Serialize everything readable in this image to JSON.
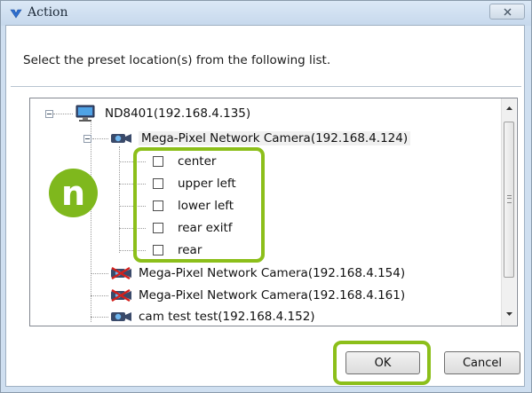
{
  "window": {
    "title": "Action",
    "close_glyph": "✕"
  },
  "prompt_text": "Select the preset location(s) from the following list.",
  "tree": {
    "root": {
      "label": "ND8401(192.168.4.135)",
      "icon": "computer-icon"
    },
    "camera_1": {
      "label": "Mega-Pixel Network Camera(192.168.4.124)",
      "icon": "camera-icon"
    },
    "presets": [
      {
        "label": "center",
        "checked": false
      },
      {
        "label": "upper left",
        "checked": false
      },
      {
        "label": "lower left",
        "checked": false
      },
      {
        "label": "rear exitf",
        "checked": false
      },
      {
        "label": "rear",
        "checked": false
      }
    ],
    "camera_2": {
      "label": "Mega-Pixel Network Camera(192.168.4.154)",
      "icon": "camera-offline-icon"
    },
    "camera_3": {
      "label": "Mega-Pixel Network Camera(192.168.4.161)",
      "icon": "camera-offline-icon"
    },
    "camera_4": {
      "label": "cam test test(192.168.4.152)",
      "icon": "camera-icon"
    }
  },
  "annotation": {
    "marker_text": "n"
  },
  "buttons": {
    "ok_label": "OK",
    "cancel_label": "Cancel"
  },
  "colors": {
    "highlight": "#8cbf1a",
    "marker": "#7fb81d",
    "offline_cross": "#d3201c"
  }
}
